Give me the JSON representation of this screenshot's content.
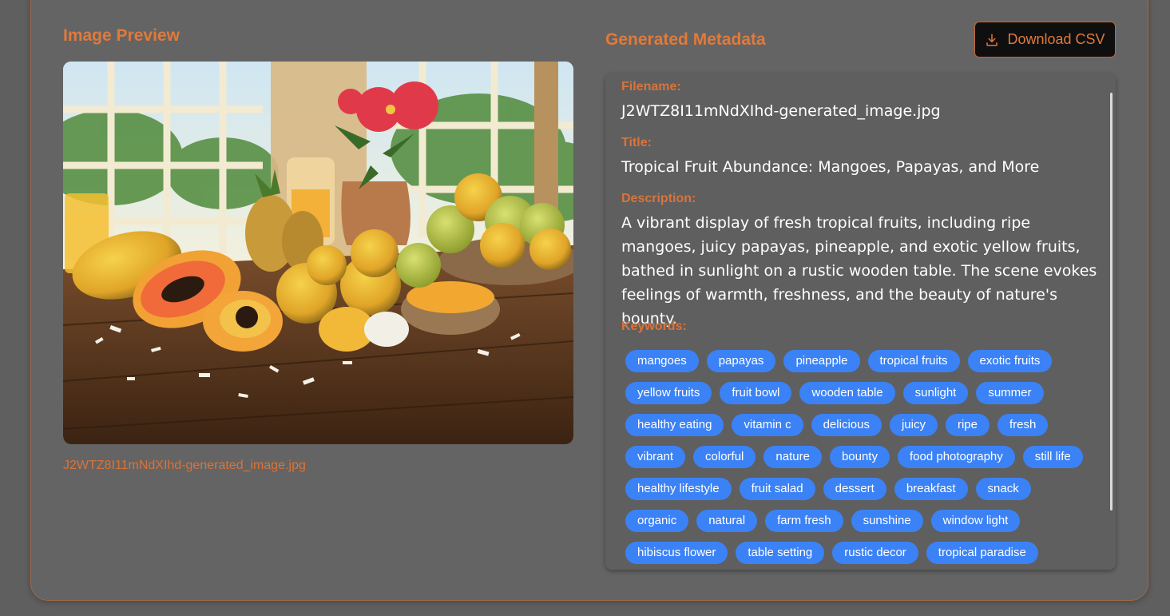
{
  "preview": {
    "title": "Image Preview",
    "caption": "J2WTZ8I11mNdXIhd-generated_image.jpg"
  },
  "metadata": {
    "title": "Generated Metadata",
    "download_label": "Download CSV",
    "download_icon": "download-icon",
    "filename_label": "Filename:",
    "filename": "J2WTZ8I11mNdXIhd-generated_image.jpg",
    "title_label": "Title:",
    "image_title": "Tropical Fruit Abundance: Mangoes, Papayas, and More",
    "description_label": "Description:",
    "description": "A vibrant display of fresh tropical fruits, including ripe mangoes, juicy papayas, pineapple, and exotic yellow fruits, bathed in sunlight on a rustic wooden table. The scene evokes feelings of warmth, freshness, and the beauty of nature's bounty.",
    "keywords_label": "Keywords:",
    "keywords": [
      "mangoes",
      "papayas",
      "pineapple",
      "tropical fruits",
      "exotic fruits",
      "yellow fruits",
      "fruit bowl",
      "wooden table",
      "sunlight",
      "summer",
      "healthy eating",
      "vitamin c",
      "delicious",
      "juicy",
      "ripe",
      "fresh",
      "vibrant",
      "colorful",
      "nature",
      "bounty",
      "food photography",
      "still life",
      "healthy lifestyle",
      "fruit salad",
      "dessert",
      "breakfast",
      "snack",
      "organic",
      "natural",
      "farm fresh",
      "sunshine",
      "window light",
      "hibiscus flower",
      "table setting",
      "rustic decor",
      "tropical paradise"
    ]
  },
  "colors": {
    "accent": "#e07a3a",
    "chip": "#3b82f6",
    "background": "#5f5f5f"
  }
}
